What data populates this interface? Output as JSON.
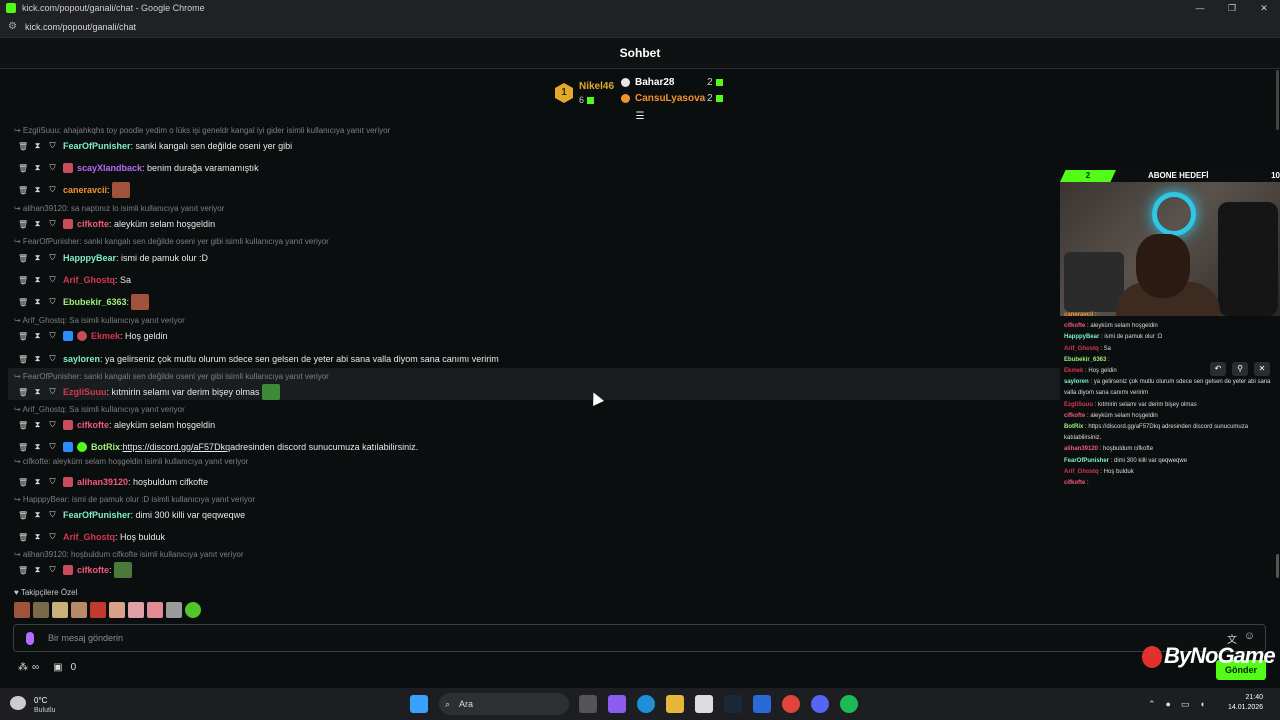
{
  "window": {
    "title": "kick.com/popout/ganali/chat - Google Chrome",
    "url": "kick.com/popout/ganali/chat",
    "controls": [
      "—",
      "❐",
      "✕"
    ]
  },
  "chat": {
    "header": "Sohbet",
    "leaderboard": {
      "first": {
        "rank": "1",
        "name": "Nikel46",
        "count": "6"
      },
      "rows": [
        {
          "name": "Bahar28",
          "count": "2",
          "color": "#ffffff",
          "badge": "#e6e6e6"
        },
        {
          "name": "CansuLyasova",
          "count": "2",
          "color": "#f2932f",
          "badge": "#f2932f"
        }
      ]
    },
    "messages": [
      {
        "reply": "EzgliSuuu: ahajahkqhs toy poodle yedim o lüks işi geneldr kangal iyi gider isimli kullanıcıya yanıt veriyor"
      },
      {
        "user": "FearOfPunisher",
        "color": "#7ff0c8",
        "text": ": sanki kangalı sen değilde oseni yer gibi"
      },
      {
        "user": "scayXlandback",
        "color": "#b86bf5",
        "text": ": benim durağa varamamıştık",
        "badge": "#c94c5d"
      },
      {
        "user": "caneravcii",
        "color": "#f2932f",
        "text": ":",
        "emote": "#a0533a"
      },
      {
        "reply": "alihan39120: sa naptınız lo isimli kullanıcıya yanıt veriyor"
      },
      {
        "user": "cifkofte",
        "color": "#f25a7a",
        "text": ": aleyküm selam hoşgeldin",
        "badge": "#c94c5d"
      },
      {
        "reply": "FearOfPunisher: sanki kangalı sen değilde oseni yer gibi isimli kullanıcıya yanıt veriyor"
      },
      {
        "user": "HapppyBear",
        "color": "#7ff0c8",
        "text": ": ismi de pamuk olur :D"
      },
      {
        "user": "Arif_Ghostq",
        "color": "#d6374e",
        "text": ": Sa"
      },
      {
        "user": "Ebubekir_6363",
        "color": "#9ff27a",
        "text": ":",
        "emote": "#a0533a"
      },
      {
        "reply": "Arif_Ghostq: Sa isimli kullanıcıya yanıt veriyor"
      },
      {
        "user": "Ekmek",
        "color": "#d6374e",
        "text": ": Hoş geldin",
        "badge": "#2a8cff",
        "badge2": "#c94c5d"
      },
      {
        "user": "sayloren",
        "color": "#7ff0c8",
        "text": ": ya gelirseniz çok mutlu olurum sdece sen gelsen de yeter abi sana valla diyom sana canımı veririm"
      },
      {
        "reply": "FearOfPunisher: sanki kangalı sen değilde oseni yer gibi isimli kullanıcıya yanıt veriyor"
      },
      {
        "user": "EzgliSuuu",
        "color": "#d6374e",
        "text": ": kıtmirin selamı var derim bişey olmas",
        "emote": "#3d8a3a"
      },
      {
        "reply": "Arif_Ghostq: Sa isimli kullanıcıya yanıt veriyor"
      },
      {
        "user": "cifkofte",
        "color": "#f25a7a",
        "text": ": aleyküm selam hoşgeldin",
        "badge": "#c94c5d"
      },
      {
        "user": "BotRix",
        "color": "#9ff27a",
        "text": ": ",
        "link": "https://discord.gg/aF57Dkq",
        "text2": " adresinden discord sunucumuza katılabilirsiniz.",
        "badge": "#2a8cff",
        "badge2": "#53fc18"
      },
      {
        "reply": "cifkofte: aleyküm selam hoşgeldin isimli kullanıcıya yanıt veriyor"
      },
      {
        "user": "alihan39120",
        "color": "#f25a7a",
        "text": ": hoşbuldum cifkofte",
        "badge": "#c94c5d"
      },
      {
        "reply": "HapppyBear: ismi de pamuk olur :D isimli kullanıcıya yanıt veriyor"
      },
      {
        "user": "FearOfPunisher",
        "color": "#7ff0c8",
        "text": ": dimi 300 killi var qeqweqwe"
      },
      {
        "user": "Arif_Ghostq",
        "color": "#d6374e",
        "text": ": Hoş bulduk"
      },
      {
        "reply": "alihan39120: hoşbuldum cifkofte isimli kullanıcıya yanıt veriyor"
      },
      {
        "user": "cifkofte",
        "color": "#f25a7a",
        "text": ":",
        "badge": "#c94c5d",
        "emote": "#4a7a3a"
      }
    ],
    "follower_label": "♥ Takipçilere Özel",
    "input_placeholder": "Bir mesaj gönderin",
    "send_label": "Gönder",
    "points": "0",
    "infinity": "∞"
  },
  "overlay": {
    "goal_label": "ABONE HEDEFİ",
    "goal_current": "2",
    "goal_target": "10",
    "lines": [
      {
        "u": "caneravcii",
        "t": " : ",
        "c": "#f2932f"
      },
      {
        "u": "cifkofte",
        "t": " : aleyküm selam hoşgeldin",
        "c": "#f25a7a"
      },
      {
        "u": "HapppyBear",
        "t": " : ismi de pamuk olur :D",
        "c": "#7ff0c8"
      },
      {
        "u": "Arif_Ghostq",
        "t": " : Sa",
        "c": "#d6374e"
      },
      {
        "u": "Ebubekir_6363",
        "t": " : ",
        "c": "#9ff27a"
      },
      {
        "u": "Ekmek",
        "t": " : Hoş geldin",
        "c": "#d6374e"
      },
      {
        "u": "sayloren",
        "t": " : ya gelirseniz çok mutlu olurum sdece sen gelsen de yeter abi sana",
        "c": "#7ff0c8"
      },
      {
        "u": "",
        "t": "valla diyom sana canımı veririm",
        "c": "#ddd"
      },
      {
        "u": "EzgliSuuu",
        "t": " : kıtmirin selamı var derim bişey olmas",
        "c": "#d6374e"
      },
      {
        "u": "cifkofte",
        "t": " : aleyküm selam hoşgeldin",
        "c": "#f25a7a"
      },
      {
        "u": "BotRix",
        "t": " : https://discord.gg/aF57Dkq adresinden discord sunucumuza",
        "c": "#9ff27a"
      },
      {
        "u": "",
        "t": "katılabilirsiniz.",
        "c": "#ddd"
      },
      {
        "u": "alihan39120",
        "t": " : hoşbuldum cifkofte",
        "c": "#f25a7a"
      },
      {
        "u": "FearOfPunisher",
        "t": " : dimi 300 killi var qeqweqwe",
        "c": "#7ff0c8"
      },
      {
        "u": "Arif_Ghostq",
        "t": " : Hoş bulduk",
        "c": "#d6374e"
      },
      {
        "u": "cifkofte",
        "t": " : ",
        "c": "#f25a7a"
      }
    ],
    "brand": "ByNoGame"
  },
  "taskbar": {
    "temp": "0°C",
    "weather": "Bulutlu",
    "search": "Ara",
    "time": "21:40",
    "date": "14.01.2026"
  }
}
